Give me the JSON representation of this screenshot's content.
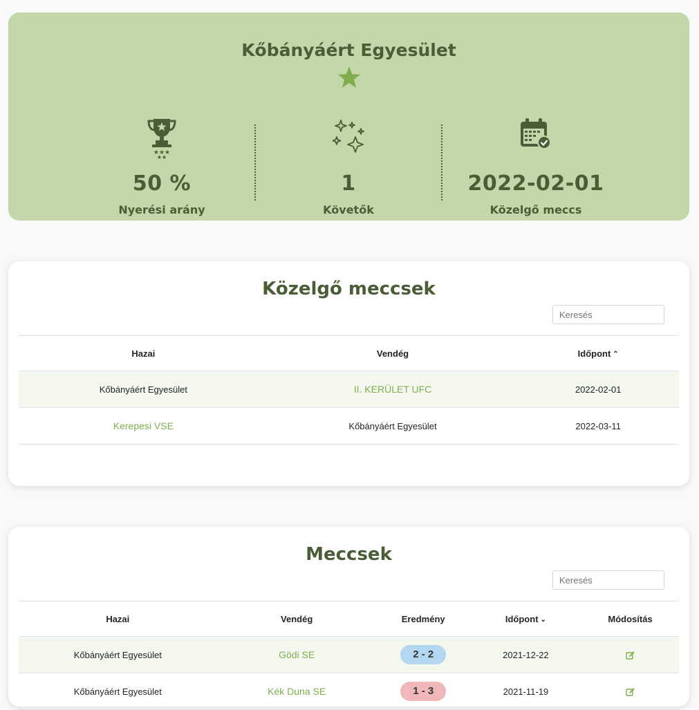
{
  "hero": {
    "title": "Kőbányáért Egyesület",
    "stats": [
      {
        "icon": "trophy-icon",
        "value": "50 %",
        "label": "Nyerési arány"
      },
      {
        "icon": "sparkles-icon",
        "value": "1",
        "label": "Követők"
      },
      {
        "icon": "calendar-check-icon",
        "value": "2022-02-01",
        "label": "Közelgő meccs"
      }
    ],
    "colors": {
      "background": "#c3d7ab",
      "accent": "#4a5d36",
      "star": "#7fae4f"
    }
  },
  "upcoming": {
    "title": "Közelgő meccsek",
    "search_placeholder": "Keresés",
    "columns": {
      "home": "Hazai",
      "away": "Vendég",
      "date": "Időpont"
    },
    "sort_icon": "chevron-up-icon",
    "rows": [
      {
        "home": "Kőbányáért Egyesület",
        "away": "II. KERÜLET UFC",
        "date": "2022-02-01"
      },
      {
        "home": "Kerepesi VSE",
        "away": "Kőbányáért Egyesület",
        "date": "2022-03-11"
      }
    ]
  },
  "matches": {
    "title": "Meccsek",
    "search_placeholder": "Keresés",
    "columns": {
      "home": "Hazai",
      "away": "Vendég",
      "result": "Eredmény",
      "date": "Időpont",
      "edit": "Módosítás"
    },
    "sort_icon": "chevron-down-icon",
    "rows": [
      {
        "home": "Kőbányáért Egyesület",
        "away": "Gödi SE",
        "result": "2 - 2",
        "result_color": "#b3d7f0",
        "date": "2021-12-22",
        "edit_icon": "edit-icon"
      },
      {
        "home": "Kőbányáért Egyesület",
        "away": "Kék Duna SE",
        "result": "1 - 3",
        "result_color": "#f0b8b8",
        "date": "2021-11-19",
        "edit_icon": "edit-icon"
      }
    ]
  }
}
